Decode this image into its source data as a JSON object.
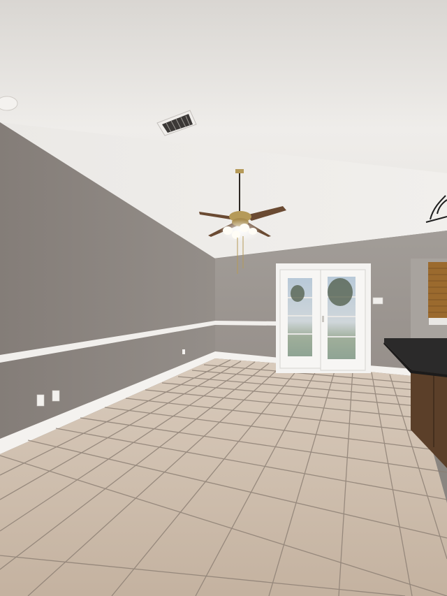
{
  "scene": {
    "subject": "empty-room-interior",
    "fixtures": [
      "ceiling-fan",
      "air-vent",
      "french-doors",
      "kitchen-counter",
      "light-fixture",
      "window-blinds"
    ],
    "colors": {
      "ceiling": "#efedea",
      "wall_left": "#8e8883",
      "wall_back": "#9d9893",
      "floor_tile": "#cbb9a7",
      "grout": "#7e7268",
      "trim": "#f3f1ee",
      "door_frame": "#f4f3f1",
      "glass": "#9fb6c9",
      "counter_top": "#2b2a2a",
      "cabinet": "#5b3f29",
      "fan_blade": "#6a4a32",
      "brass": "#b59a59"
    }
  }
}
